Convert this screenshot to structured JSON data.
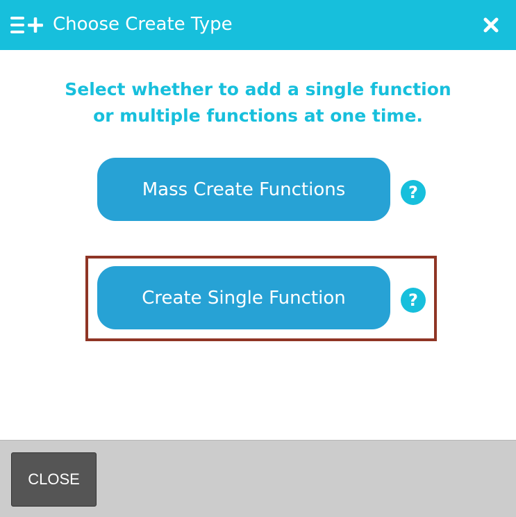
{
  "header": {
    "icon": "list-add-icon",
    "title": "Choose Create Type",
    "close_icon": "close-icon"
  },
  "instructions": {
    "line1": "Select whether to add a single function",
    "line2": "or multiple functions at one time."
  },
  "options": [
    {
      "label": "Mass Create Functions",
      "help_symbol": "?",
      "highlighted": false
    },
    {
      "label": "Create Single Function",
      "help_symbol": "?",
      "highlighted": true
    }
  ],
  "footer": {
    "close_label": "CLOSE"
  },
  "colors": {
    "header_bg": "#17bfdc",
    "button_bg": "#27a2d5",
    "highlight_border": "#8f3525",
    "footer_bg": "#cccccc",
    "close_button_bg": "#555555"
  }
}
